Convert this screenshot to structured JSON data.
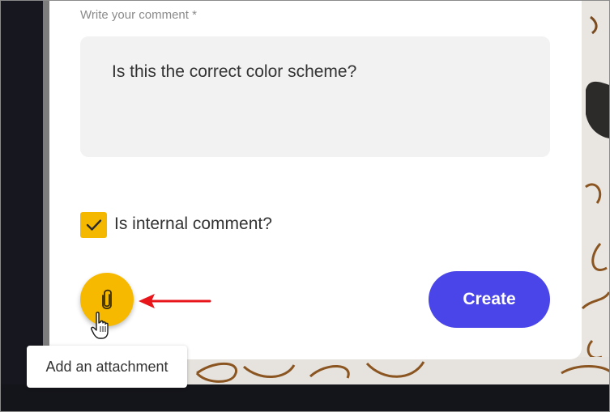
{
  "form": {
    "comment_label": "Write your comment *",
    "comment_value": "Is this the correct color scheme?",
    "internal_checkbox_label": "Is internal comment?",
    "internal_checked": true,
    "create_button_label": "Create"
  },
  "attachment": {
    "icon": "paperclip-icon",
    "tooltip": "Add an attachment"
  },
  "colors": {
    "primary_button": "#4a45e8",
    "accent_yellow": "#f7b900",
    "annotation_arrow": "#e8151b"
  }
}
